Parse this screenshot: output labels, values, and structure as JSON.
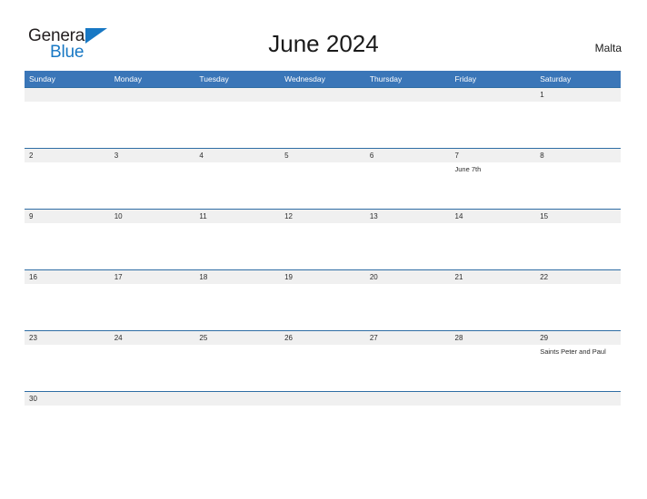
{
  "brand": {
    "name_part1": "General",
    "name_part2": "Blue",
    "flag_icon": "flag-triangle-icon"
  },
  "header": {
    "title": "June 2024",
    "country": "Malta"
  },
  "calendar": {
    "weekday_headers": [
      "Sunday",
      "Monday",
      "Tuesday",
      "Wednesday",
      "Thursday",
      "Friday",
      "Saturday"
    ],
    "colors": {
      "header_blue": "#3a76b8",
      "rule_blue": "#2e6da4",
      "date_band_gray": "#f0f0f0",
      "logo_blue": "#1878c4",
      "text_dark": "#2b2b2b"
    },
    "weeks": [
      {
        "short": false,
        "days": [
          {
            "date": "",
            "events": []
          },
          {
            "date": "",
            "events": []
          },
          {
            "date": "",
            "events": []
          },
          {
            "date": "",
            "events": []
          },
          {
            "date": "",
            "events": []
          },
          {
            "date": "",
            "events": []
          },
          {
            "date": "1",
            "events": []
          }
        ]
      },
      {
        "short": false,
        "days": [
          {
            "date": "2",
            "events": []
          },
          {
            "date": "3",
            "events": []
          },
          {
            "date": "4",
            "events": []
          },
          {
            "date": "5",
            "events": []
          },
          {
            "date": "6",
            "events": []
          },
          {
            "date": "7",
            "events": [
              "June 7th"
            ]
          },
          {
            "date": "8",
            "events": []
          }
        ]
      },
      {
        "short": false,
        "days": [
          {
            "date": "9",
            "events": []
          },
          {
            "date": "10",
            "events": []
          },
          {
            "date": "11",
            "events": []
          },
          {
            "date": "12",
            "events": []
          },
          {
            "date": "13",
            "events": []
          },
          {
            "date": "14",
            "events": []
          },
          {
            "date": "15",
            "events": []
          }
        ]
      },
      {
        "short": false,
        "days": [
          {
            "date": "16",
            "events": []
          },
          {
            "date": "17",
            "events": []
          },
          {
            "date": "18",
            "events": []
          },
          {
            "date": "19",
            "events": []
          },
          {
            "date": "20",
            "events": []
          },
          {
            "date": "21",
            "events": []
          },
          {
            "date": "22",
            "events": []
          }
        ]
      },
      {
        "short": false,
        "days": [
          {
            "date": "23",
            "events": []
          },
          {
            "date": "24",
            "events": []
          },
          {
            "date": "25",
            "events": []
          },
          {
            "date": "26",
            "events": []
          },
          {
            "date": "27",
            "events": []
          },
          {
            "date": "28",
            "events": []
          },
          {
            "date": "29",
            "events": [
              "Saints Peter and Paul"
            ]
          }
        ]
      },
      {
        "short": true,
        "days": [
          {
            "date": "30",
            "events": []
          },
          {
            "date": "",
            "events": []
          },
          {
            "date": "",
            "events": []
          },
          {
            "date": "",
            "events": []
          },
          {
            "date": "",
            "events": []
          },
          {
            "date": "",
            "events": []
          },
          {
            "date": "",
            "events": []
          }
        ]
      }
    ]
  }
}
